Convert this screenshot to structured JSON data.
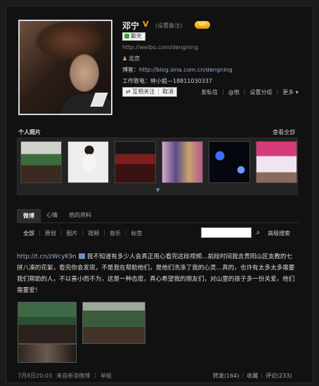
{
  "profile": {
    "name": "邓宁",
    "verified_mark": "V",
    "remark": "(设置备注)",
    "vip_badge": "VIP",
    "chat_label": "聊天",
    "weibo_url": "http://weibo.com/dengning",
    "location": "北京",
    "blog_label": "博客：",
    "blog_url": "http://blog.sina.com.cn/dengning",
    "contact": "工作致电：林小姐—18811030337",
    "follow_status": "⇄ 互相关注",
    "cancel": "取消",
    "actions": [
      "发私信",
      "@他",
      "设置分组",
      "更多 ▾"
    ]
  },
  "photos": {
    "title": "个人照片",
    "view_all": "查看全部",
    "count": 6
  },
  "tabs": [
    "微博",
    "心情",
    "他的资料"
  ],
  "filters": [
    "全部",
    "原创",
    "图片",
    "视频",
    "音乐",
    "标签"
  ],
  "search": {
    "placeholder": "",
    "advanced": "高级搜索"
  },
  "post": {
    "link": "http://t.cn/zWcyK9n",
    "text": "我不知道有多少人会真正用心看完这段视频…前段时间我去贵阳山区支教的七拼八凑的花絮，看完你会发现，不是我在帮助他们，是他们洗涤了我的心灵…真的，也许有太多太多需要我们帮助的人，不以善小而不为，这是一种态度，真心希望我的朋友们，对山里的孩子多一份关爱，他们需要爱！",
    "date": "7月8日20:03",
    "source": "来自新浪微博",
    "report": "举报",
    "repost": "转发(164)",
    "collect": "收藏",
    "comment": "评论(233)"
  },
  "colors": {
    "background": "#111111",
    "link": "#8fb0d6",
    "verified": "#ff9c1a"
  }
}
